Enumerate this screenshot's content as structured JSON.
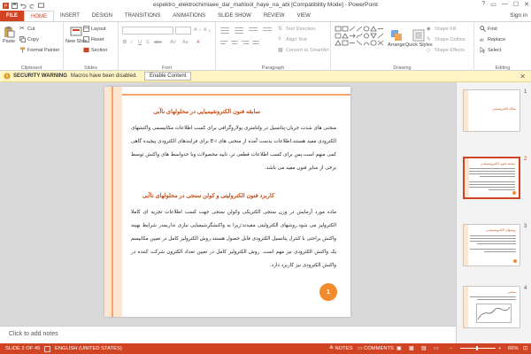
{
  "window": {
    "title": "espektro_elektrochimiaee_dar_mahlool_haye_na_abi [Compatibility Mode] - PowerPoint",
    "signin": "Sign in",
    "controls": [
      "?",
      "▭",
      "—",
      "☐",
      "✕"
    ]
  },
  "tabs": [
    "FILE",
    "HOME",
    "INSERT",
    "DESIGN",
    "TRANSITIONS",
    "ANIMATIONS",
    "SLIDE SHOW",
    "REVIEW",
    "VIEW"
  ],
  "ribbon": {
    "clipboard": {
      "label": "Clipboard",
      "paste": "Paste",
      "cut": "Cut",
      "copy": "Copy",
      "format_painter": "Format Painter"
    },
    "slides": {
      "label": "Slides",
      "new_slide": "New Slide",
      "layout": "Layout",
      "reset": "Reset",
      "section": "Section"
    },
    "font": {
      "label": "Font"
    },
    "paragraph": {
      "label": "Paragraph",
      "text_direction": "Text Direction",
      "align_text": "Align Text",
      "convert": "Convert to SmartArt"
    },
    "drawing": {
      "label": "Drawing",
      "arrange": "Arrange",
      "quick_styles": "Quick Styles",
      "shape_fill": "Shape Fill",
      "shape_outline": "Shape Outline",
      "shape_effects": "Shape Effects"
    },
    "editing": {
      "label": "Editing",
      "find": "Find",
      "replace": "Replace",
      "select": "Select"
    }
  },
  "security_bar": {
    "label": "SECURITY WARNING",
    "message": "Macros have been disabled.",
    "button": "Enable Content"
  },
  "slide": {
    "heading1": "سابقه فنون الکتروشیمیایی در محلولهای ناآبی",
    "para1": "منحنی های شدت جریان-پتانسیل در ولتامتری پولاروگرافی برای کسب اطلاعات مکانیسمی واکنشهای الکترودی مفید هستند.اطلاعات بدست آمده از منحنی های E-i برای فرایندهای الکترودی پیچیده گاهی کمی مبهم است.پس برای کسب اطلاعات قطعی تر، تایید محصولات وبا حدواسط های واکنش توسط برخی از سایر فنون مفید می باشد.",
    "heading2": "کاربرد فنون الکترولیتی و کولن سنجی در محلولهای ناآبی",
    "para2": "ماده مورد آزمایش در وزن سنجی الکتریکی وکولن سنجی جهت کسب اطلاعات تجزیه ای کاملا الکترولیز می شود.روشهای الکترولیتی مفیدند؛زیرا به واکنشگرشیمیایی نیازی نداریمدر شرایط بهینه واکنش براحتی با کنترل پتانسیل الکترودی قابل حصول هستند.روش الکترولیز کامل در تعیین مکانیسم یک واکنش الکترودی نیز مهم است. روش الکترولیز کامل در تعیین تعداد الکترون شرکت کننده در واکنش الکترودی نیز کاربرد دارد.",
    "page_number": "1"
  },
  "notes_placeholder": "Click to add notes",
  "thumbnails": [
    {
      "num": "1",
      "title": "مقاله الکتروشیمی"
    },
    {
      "num": "2",
      "title": "سابقه فنون الکتروشیمیایی"
    },
    {
      "num": "3",
      "title": "روشهای الکتروشیمیایی"
    },
    {
      "num": "4",
      "title": "منحنی"
    }
  ],
  "status": {
    "slide_info": "SLIDE 2 OF 45",
    "language": "ENGLISH (UNITED STATES)",
    "notes": "NOTES",
    "comments": "COMMENTS",
    "zoom": "66%"
  },
  "colors": {
    "accent": "#d04423",
    "orange": "#f28a2e",
    "stripe": "#ffe6d1",
    "warning_bg": "#fff4c4"
  }
}
